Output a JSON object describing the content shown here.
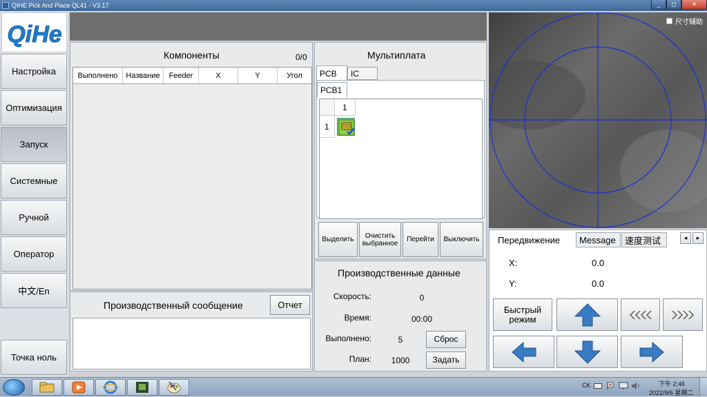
{
  "window": {
    "title": "QIHE Pick And Place   QL41 - V3.17",
    "min_label": "_",
    "max_label": "◻",
    "close_label": "✕"
  },
  "logo": {
    "text": "QiHe"
  },
  "nav": {
    "items": [
      {
        "label": "Настройка"
      },
      {
        "label": "Оптимизация"
      },
      {
        "label": "Запуск"
      },
      {
        "label": "Системные"
      },
      {
        "label": "Ручной"
      },
      {
        "label": "Оператор"
      },
      {
        "label": "中文/En"
      }
    ],
    "zero_point": "Точка ноль"
  },
  "components": {
    "title": "Компоненты",
    "count": "0/0",
    "columns": [
      "Выполнено",
      "Название",
      "Feeder",
      "X",
      "Y",
      "Угол"
    ]
  },
  "messages": {
    "title": "Производственный сообщение",
    "report_button": "Отчет"
  },
  "multiboard": {
    "title": "Мультиплата",
    "tabs": [
      "PCB",
      "IC"
    ],
    "subtabs": [
      "PCB1"
    ],
    "grid_col_header": "1",
    "grid_row_header": "1",
    "buttons": [
      "Выделить",
      "Очистить выбранное",
      "Перейти",
      "Выключить"
    ]
  },
  "production": {
    "title": "Производственные данные",
    "speed_label": "Скорость:",
    "speed_value": "0",
    "time_label": "Время:",
    "time_value": "00:00",
    "done_label": "Выполнено:",
    "done_value": "5",
    "reset_button": "Сброс",
    "plan_label": "План:",
    "plan_value": "1000",
    "set_button": "Задать"
  },
  "camera": {
    "aux_label": "尺寸辅助"
  },
  "motion": {
    "tabs": [
      "Передвижение",
      "Message",
      "速度测试"
    ],
    "x_label": "X:",
    "x_value": "0.0",
    "y_label": "Y:",
    "y_value": "0.0",
    "fast_mode": "Быстрый режим"
  },
  "taskbar": {
    "lang": "CK",
    "time": "下午 2:46",
    "date": "2022/9/6 星期二"
  }
}
